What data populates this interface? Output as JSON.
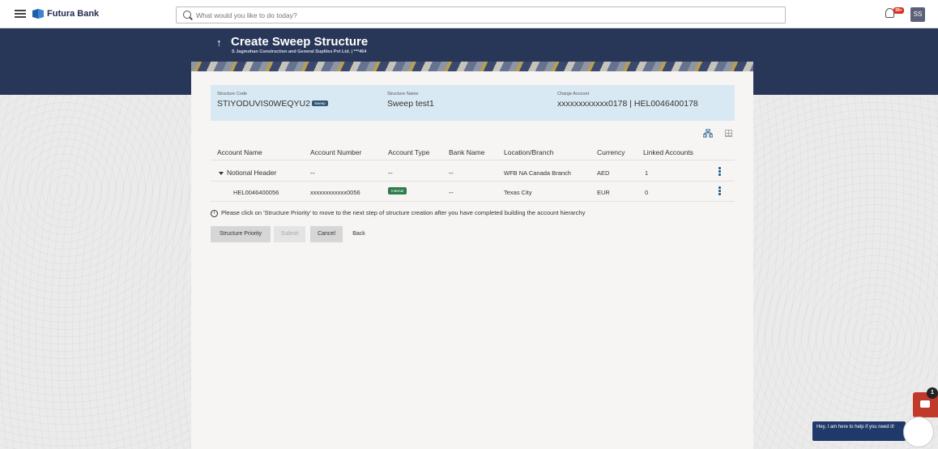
{
  "topbar": {
    "brand": "Futura Bank",
    "search_placeholder": "What would you like to do today?",
    "notification_count": "99+",
    "user_initials": "SS"
  },
  "header": {
    "title": "Create Sweep Structure",
    "subtitle": "S Jagmohan Construction and General Supllies Pvt Ltd. | ***464"
  },
  "structure": {
    "code_label": "Structure Code",
    "code_value": "STIYODUVIS0WEQYU2",
    "code_tag": "Sweep",
    "name_label": "Structure Name",
    "name_value": "Sweep test1",
    "charge_label": "Charge Account",
    "charge_value": "xxxxxxxxxxxx0178 | HEL0046400178"
  },
  "table": {
    "headers": [
      "Account Name",
      "Account Number",
      "Account Type",
      "Bank Name",
      "Location/Branch",
      "Currency",
      "Linked Accounts"
    ],
    "rows": [
      {
        "account_name": "Notional Header",
        "account_number": "--",
        "account_type": "--",
        "bank_name": "--",
        "location": "WFB NA Canada Branch",
        "currency": "AED",
        "linked": "1"
      },
      {
        "account_name": "HEL0046400056",
        "account_number": "xxxxxxxxxxxx0056",
        "account_type": "Internal",
        "bank_name": "--",
        "location": "Texas City",
        "currency": "EUR",
        "linked": "0"
      }
    ]
  },
  "info_note": "Please click on 'Structure Priority' to move to the next step of structure creation after you have completed building the account hierarchy",
  "buttons": {
    "structure_priority": "Structure Priority",
    "submit": "Submit",
    "cancel": "Cancel",
    "back": "Back"
  },
  "chat": {
    "badge": "1",
    "message": "Hey, I am here to help if you need it!"
  },
  "colors": {
    "header_bg": "#283658",
    "info_panel_bg": "#d8e9f3",
    "internal_tag": "#2e7d4c",
    "chat_red": "#c0392b"
  }
}
